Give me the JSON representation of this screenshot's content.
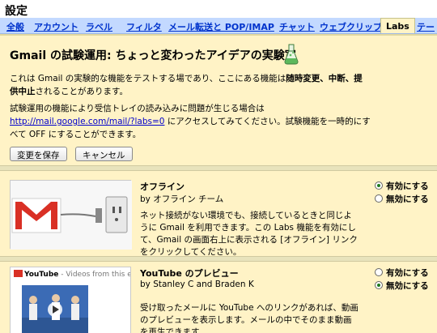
{
  "settings_title": "設定",
  "tabs": [
    "全般",
    "アカウント",
    "ラベル",
    "フィルタ",
    "メール転送と POP/IMAP",
    "チャット",
    "ウェブクリップ",
    "Labs",
    "テー"
  ],
  "active_tab": "Labs",
  "heading": "Gmail の試験運用: ちょっと変わったアイデアの実験室",
  "intro": {
    "line1_a": "これは Gmail の実験的な機能をテストする場であり、ここにある機能は",
    "line1_b": "随時変更、中断、提",
    "line2_a": "供中止",
    "line2_b": "されることがあります。"
  },
  "intro2": {
    "line1": "試験運用の機能により受信トレイの読み込みに問題が生じる場合は",
    "link": "http://mail.google.com/mail/?labs=0",
    "line2_rest": " にアクセスしてみてください。試験機能を一時的にす",
    "line3": "べて OFF にすることができます。"
  },
  "buttons": {
    "save": "変更を保存",
    "cancel": "キャンセル"
  },
  "features": [
    {
      "title": "オフライン",
      "by": "by オフライン チーム",
      "desc": "ネット接続がない環境でも、接続しているときと同じように Gmail を利用できます。この Labs 機能を有効にして、Gmail の画面右上に表示される [オフライン] リンクをクリックしてください。",
      "enable_label": "有効にする",
      "disable_label": "無効にする",
      "selected": "enable"
    },
    {
      "title": "YouTube のプレビュー",
      "by": "by Stanley C and Braden K",
      "desc": "受け取ったメールに YouTube へのリンクがあれば、動画のプレビューを表示します。メールの中でそのまま動画を再生できます。",
      "enable_label": "有効にする",
      "disable_label": "無効にする",
      "selected": "disable",
      "thumb_logo": "YouTube",
      "thumb_caption": "- Videos from this email"
    }
  ],
  "colors": {
    "tab_bar": "#c3d9ff",
    "panel": "#fff3c6",
    "link": "#0000cc",
    "gmail_red": "#d93025"
  }
}
